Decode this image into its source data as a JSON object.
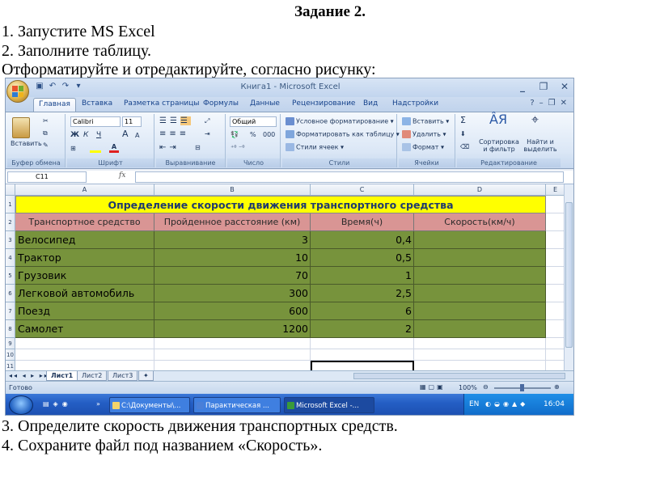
{
  "document": {
    "heading": "Задание 2.",
    "step1": "1. Запустите MS Excel",
    "step2": "2. Заполните таблицу.",
    "step2b": "Отформатируйте и отредактируйте, согласно рисунку:",
    "step3": "3. Определите скорость движения транспортных средств.",
    "step4": "4. Сохраните файл под названием «Скорость»."
  },
  "excel": {
    "window_title": "Книга1 - Microsoft Excel",
    "tabs": [
      "Главная",
      "Вставка",
      "Разметка страницы",
      "Формулы",
      "Данные",
      "Рецензирование",
      "Вид",
      "Надстройки"
    ],
    "active_tab": "Главная",
    "ribbon": {
      "clipboard": {
        "paste": "Вставить",
        "label": "Буфер обмена"
      },
      "font": {
        "name": "Calibri",
        "size": "11",
        "label": "Шрифт",
        "bold": "Ж",
        "italic": "К",
        "underline": "Ч",
        "grow": "A",
        "shrink": "A"
      },
      "alignment": {
        "label": "Выравнивание"
      },
      "number": {
        "format": "Общий",
        "label": "Число",
        "percent": "%",
        "thousands": "000"
      },
      "styles": {
        "conditional": "Условное форматирование",
        "as_table": "Форматировать как таблицу",
        "cell_styles": "Стили ячеек",
        "label": "Стили"
      },
      "cells": {
        "insert": "Вставить",
        "delete": "Удалить",
        "format": "Формат",
        "label": "Ячейки"
      },
      "editing": {
        "sum": "Σ",
        "sort": "Сортировка и фильтр",
        "find": "Найти и выделить",
        "label": "Редактирование"
      }
    },
    "name_box": "C11",
    "fx": "fx",
    "columns": [
      "A",
      "B",
      "C",
      "D",
      "E"
    ],
    "rows": [
      "1",
      "2",
      "3",
      "4",
      "5",
      "6",
      "7",
      "8",
      "9",
      "10",
      "11"
    ],
    "table": {
      "title": "Определение скорости движения транспортного средства",
      "headers": [
        "Транспортное средство",
        "Пройденное расстояние (км)",
        "Время(ч)",
        "Скорость(км/ч)"
      ],
      "data": [
        [
          "Велосипед",
          "3",
          "0,4",
          ""
        ],
        [
          "Трактор",
          "10",
          "0,5",
          ""
        ],
        [
          "Грузовик",
          "70",
          "1",
          ""
        ],
        [
          "Легковой автомобиль",
          "300",
          "2,5",
          ""
        ],
        [
          "Поезд",
          "600",
          "6",
          ""
        ],
        [
          "Самолет",
          "1200",
          "2",
          ""
        ]
      ]
    },
    "sheets": [
      "Лист1",
      "Лист2",
      "Лист3"
    ],
    "status": "Готово",
    "zoom": "100%",
    "taskbar": {
      "items": [
        "C:\\Документы\\...",
        "Парактическая ...",
        "Microsoft Excel -..."
      ],
      "lang": "EN",
      "time": "16:04"
    },
    "colors": {
      "title_fill": "#ffff00",
      "header_fill": "#d99594",
      "data_fill": "#77933c"
    }
  }
}
